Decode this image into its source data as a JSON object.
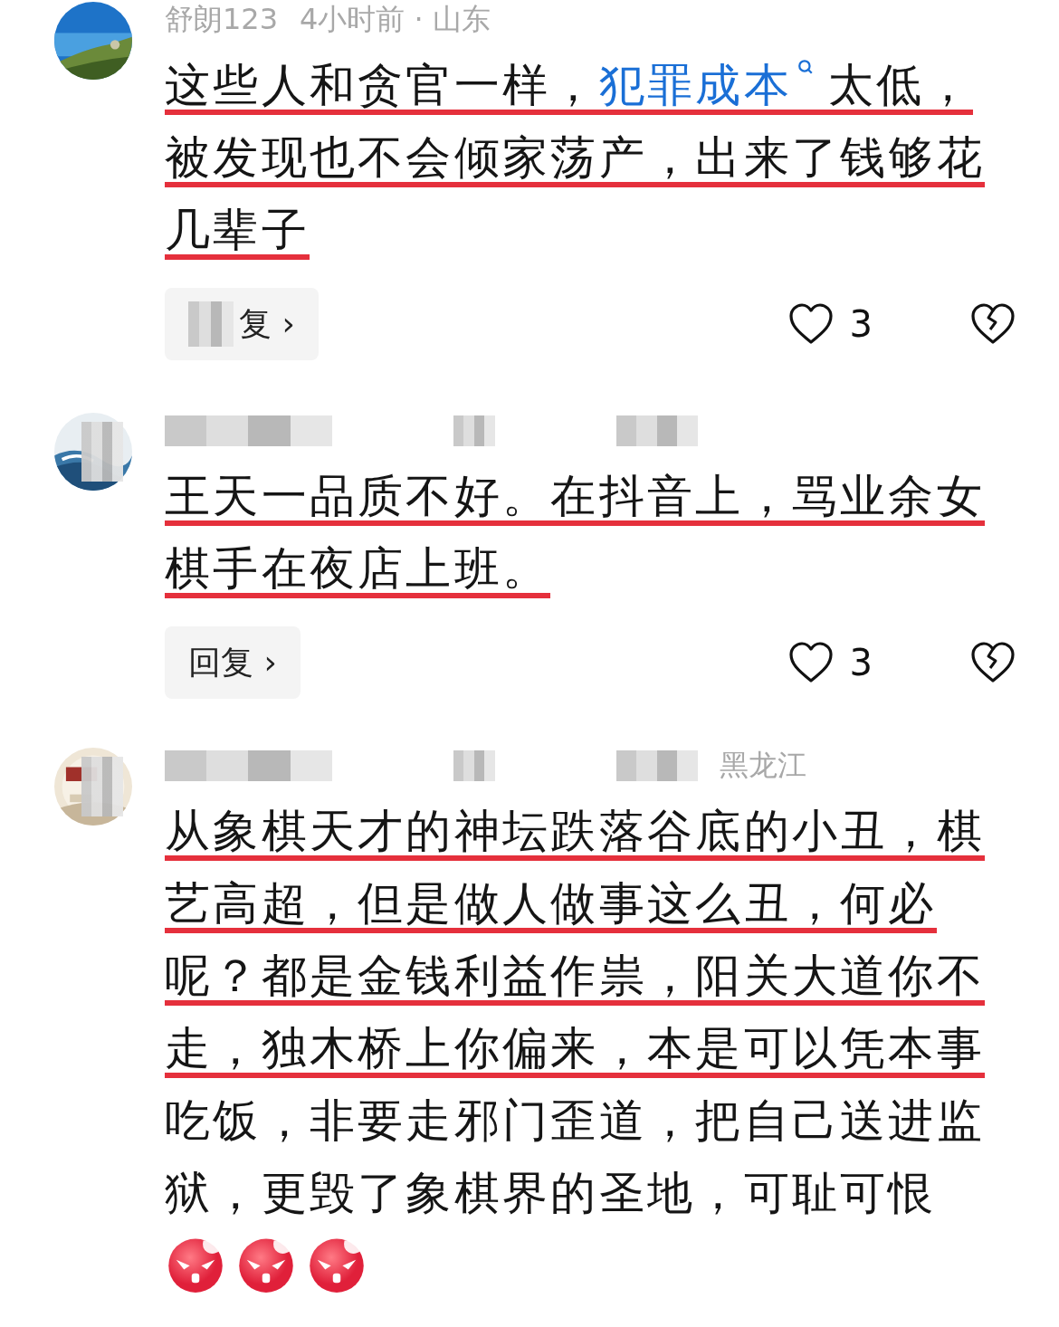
{
  "comments": [
    {
      "avatar": {
        "kind": "picture",
        "redacted": false
      },
      "author": "舒朗123",
      "meta": "4小时前 · 山东",
      "header_redacted": false,
      "text": [
        {
          "kind": "plain",
          "text": "这些人和贪官一样，",
          "underlined": true
        },
        {
          "kind": "link",
          "text": "犯罪成本",
          "underlined": true
        },
        {
          "kind": "plain",
          "text": "太低，被发现也不会倾家荡产，出来了钱够花几辈子",
          "underlined": true
        }
      ],
      "reply": {
        "label": "复 ›",
        "redacted": true
      },
      "likes": "3"
    },
    {
      "avatar": {
        "kind": "picture",
        "redacted": true
      },
      "header_redacted": true,
      "text": [
        {
          "kind": "plain",
          "text": "王天一品质不好。在抖音上，骂业余女棋手在夜店上班。",
          "underlined": true
        }
      ],
      "reply": {
        "label": "回复 ›",
        "redacted": false
      },
      "likes": "3"
    },
    {
      "avatar": {
        "kind": "picture",
        "redacted": true
      },
      "meta": "黑龙江",
      "header_redacted": true,
      "text": [
        {
          "kind": "plain",
          "text": "从象棋天才的神坛跌落谷底的小丑，棋艺高超，但是做人做事这么丑，何必呢？都是金钱利益作祟，阳关大道你不走，独木桥上你偏来，本是可以凭本事",
          "underlined": true
        },
        {
          "kind": "plain",
          "text": "吃饭，非要走邪门歪道，把自己送进监狱，更毁了象棋界的圣地，可耻可恨",
          "underlined": false
        }
      ],
      "emojis": [
        {
          "kind": "angry"
        },
        {
          "kind": "angry"
        },
        {
          "kind": "angry"
        }
      ]
    }
  ]
}
